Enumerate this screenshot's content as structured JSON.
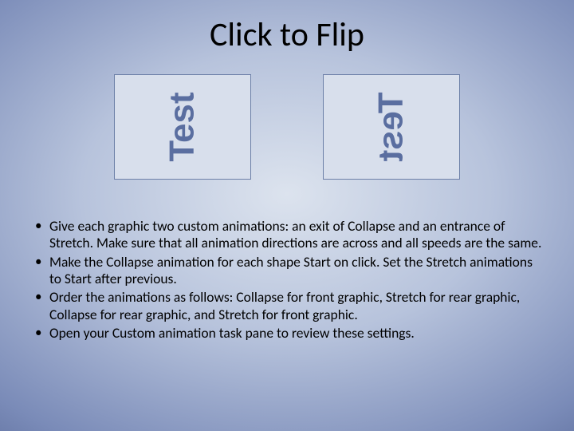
{
  "title": "Click to Flip",
  "graphics": {
    "left_text": "Test",
    "right_text": "Test"
  },
  "bullets": [
    "Give each graphic two custom animations: an exit of Collapse and an entrance of Stretch.  Make sure that all animation directions are across and all speeds are the same.",
    "Make the Collapse animation for each shape Start on click.  Set the Stretch animations to Start after previous.",
    "Order the animations as follows:   Collapse for front graphic, Stretch for rear graphic, Collapse for rear graphic, and Stretch for front graphic.",
    "Open your Custom animation task pane to review these settings."
  ]
}
